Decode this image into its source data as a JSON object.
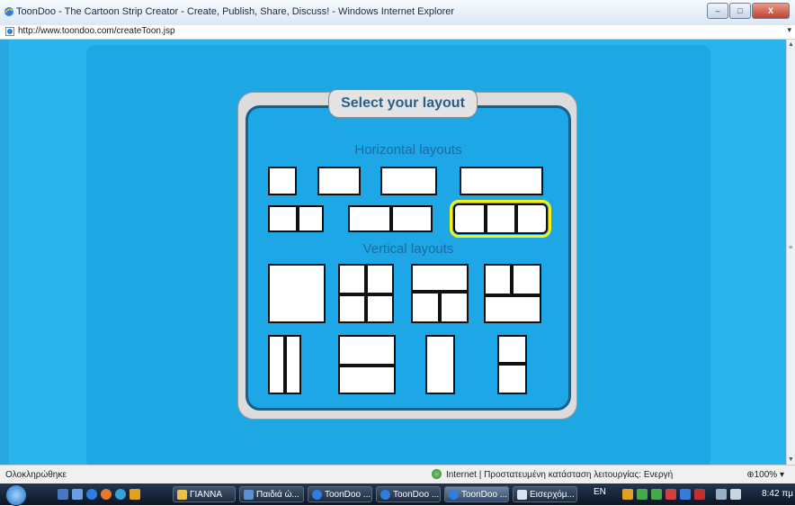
{
  "window": {
    "title": "ToonDoo - The Cartoon Strip Creator - Create, Publish, Share, Discuss! - Windows Internet Explorer",
    "min": "–",
    "max": "□",
    "close": "X"
  },
  "address": {
    "url": "http://www.toondoo.com/createToon.jsp"
  },
  "dialog": {
    "title": "Select your layout",
    "horizontal_label": "Horizontal layouts",
    "vertical_label": "Vertical layouts"
  },
  "status": {
    "left": "Ολοκληρώθηκε",
    "zone": "Internet | Προστατευμένη κατάσταση λειτουργίας: Ενεργή",
    "zoom": "⊕100%  ▾"
  },
  "taskbar": {
    "tasks": [
      "ΓΙΑΝΝΑ",
      "Παιδιά ώ...",
      "ToonDoo ...",
      "ToonDoo ...",
      "ToonDoo ...",
      "Εισερχόμ..."
    ],
    "lang": "EN",
    "clock": "8:42 πμ"
  },
  "colors": {
    "page_bg": "#2ab4ec",
    "dialog_blue": "#1ea7e6",
    "label_blue": "#1b6aa6",
    "selected_outline": "#f7f212"
  }
}
